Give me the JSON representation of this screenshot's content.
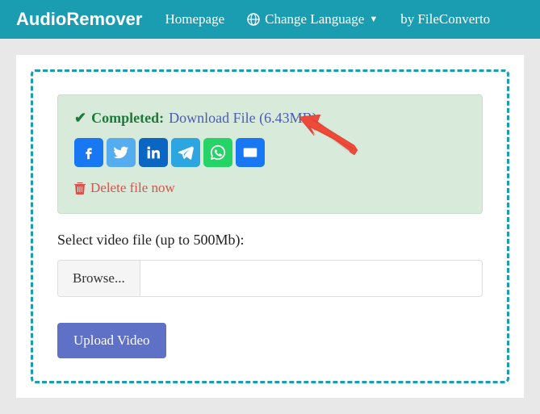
{
  "nav": {
    "logo": "AudioRemover",
    "homepage": "Homepage",
    "change_language": "Change Language",
    "by": "by FileConverto"
  },
  "success": {
    "completed": "Completed:",
    "download": "Download File (6.43MB)",
    "delete": "Delete file now"
  },
  "form": {
    "select_label": "Select video file (up to 500Mb):",
    "browse": "Browse...",
    "upload": "Upload Video"
  }
}
